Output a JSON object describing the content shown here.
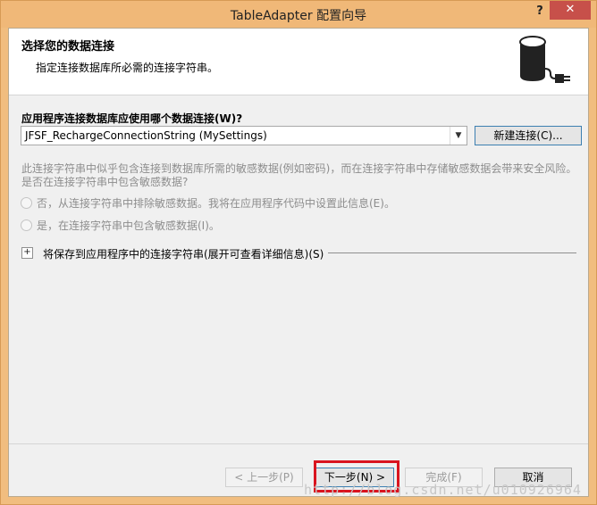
{
  "window": {
    "title": "TableAdapter 配置向导",
    "help_label": "?",
    "close_label": "✕"
  },
  "header": {
    "title": "选择您的数据连接",
    "subtitle": "指定连接数据库所必需的连接字符串。",
    "icon": "database-plug-icon"
  },
  "connection": {
    "question": "应用程序连接数据库应使用哪个数据连接(W)?",
    "selected": "JFSF_RechargeConnectionString (MySettings)",
    "new_connection_label": "新建连接(C)..."
  },
  "sensitive": {
    "message_line1": "此连接字符串中似乎包含连接到数据库所需的敏感数据(例如密码)，而在连接字符串中存储敏感数据会带来安全风险。",
    "message_line2": "是否在连接字符串中包含敏感数据?",
    "option_no": "否，从连接字符串中排除敏感数据。我将在应用程序代码中设置此信息(E)。",
    "option_yes": "是，在连接字符串中包含敏感数据(I)。"
  },
  "expander": {
    "toggle": "+",
    "label": "将保存到应用程序中的连接字符串(展开可查看详细信息)(S)"
  },
  "footer": {
    "prev_label": "< 上一步(P)",
    "next_label": "下一步(N) >",
    "finish_label": "完成(F)",
    "cancel_label": "取消"
  },
  "watermark": "http://blog.csdn.net/u010926964",
  "colors": {
    "title_bar": "#f0b878",
    "close_button": "#c7504a",
    "highlight_border": "#d9141f",
    "primary_button_border": "#3c7fb1"
  }
}
